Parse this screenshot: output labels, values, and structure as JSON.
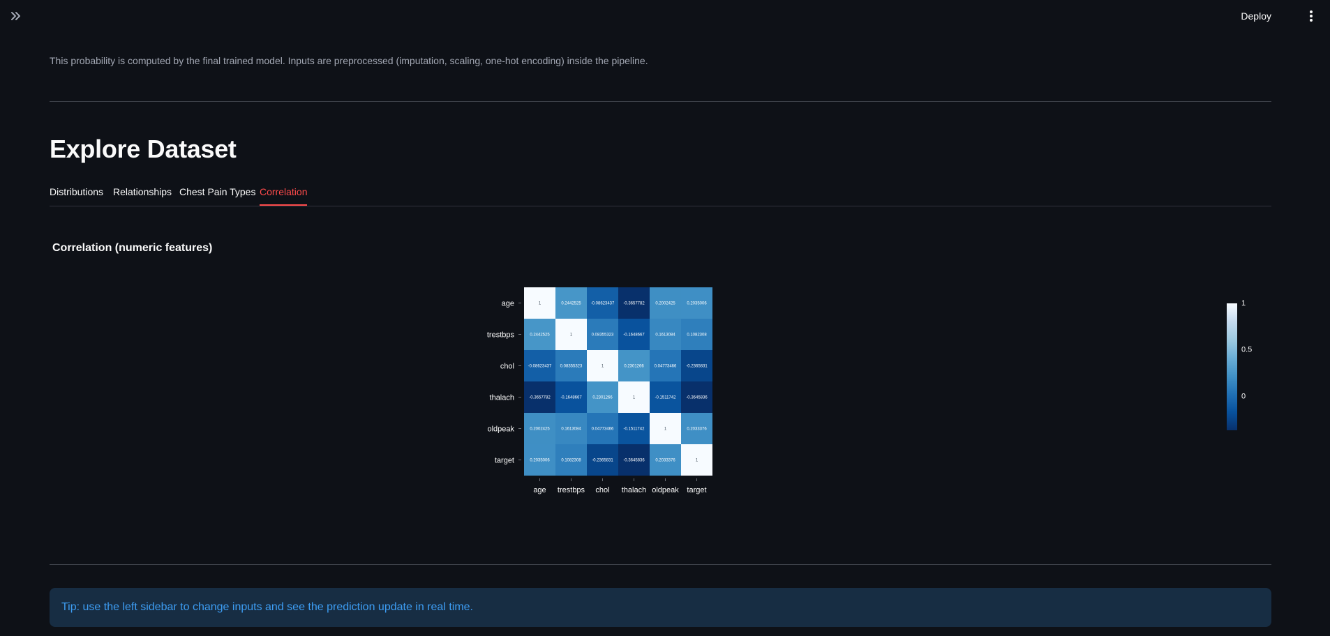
{
  "header": {
    "deploy_label": "Deploy"
  },
  "icons": {
    "expand": "double-chevron-right-icon",
    "menu": "vertical-dots-icon"
  },
  "main": {
    "probability_note": "This probability is computed by the final trained model. Inputs are preprocessed (imputation, scaling, one-hot encoding) inside the pipeline.",
    "title": "Explore Dataset",
    "tabs": [
      {
        "label": "Distributions",
        "active": false
      },
      {
        "label": "Relationships",
        "active": false
      },
      {
        "label": "Chest Pain Types",
        "active": false
      },
      {
        "label": "Correlation",
        "active": true
      }
    ],
    "chart_title": "Correlation (numeric features)",
    "tip": "Tip: use the left sidebar to change inputs and see the prediction update in real time."
  },
  "colors": {
    "accent": "#ff4b4b",
    "tip_text": "#3d9df3",
    "tip_bg": "#172d43",
    "background": "#0e1117"
  },
  "chart_data": {
    "type": "heatmap",
    "x_categories": [
      "age",
      "trestbps",
      "chol",
      "thalach",
      "oldpeak",
      "target"
    ],
    "y_categories": [
      "age",
      "trestbps",
      "chol",
      "thalach",
      "oldpeak",
      "target"
    ],
    "values": [
      [
        1,
        0.2442525,
        -0.08623437,
        -0.3657782,
        0.2002425,
        0.2035006
      ],
      [
        0.2442525,
        1,
        0.08355323,
        -0.1648667,
        0.1613084,
        0.1082308
      ],
      [
        -0.08623437,
        0.08355323,
        1,
        0.2301266,
        0.04773466,
        -0.2365831
      ],
      [
        -0.3657782,
        -0.1648667,
        0.2301266,
        1,
        -0.1511742,
        -0.3645836
      ],
      [
        0.2002425,
        0.1613084,
        0.04773466,
        -0.1511742,
        1,
        0.2033376
      ],
      [
        0.2035006,
        0.1082308,
        -0.2365831,
        -0.3645836,
        0.2033376,
        1
      ]
    ],
    "colorscale": "Blues",
    "zrange": [
      -0.3657782,
      1
    ],
    "colorbar_ticks": [
      0,
      0.5,
      1
    ]
  }
}
